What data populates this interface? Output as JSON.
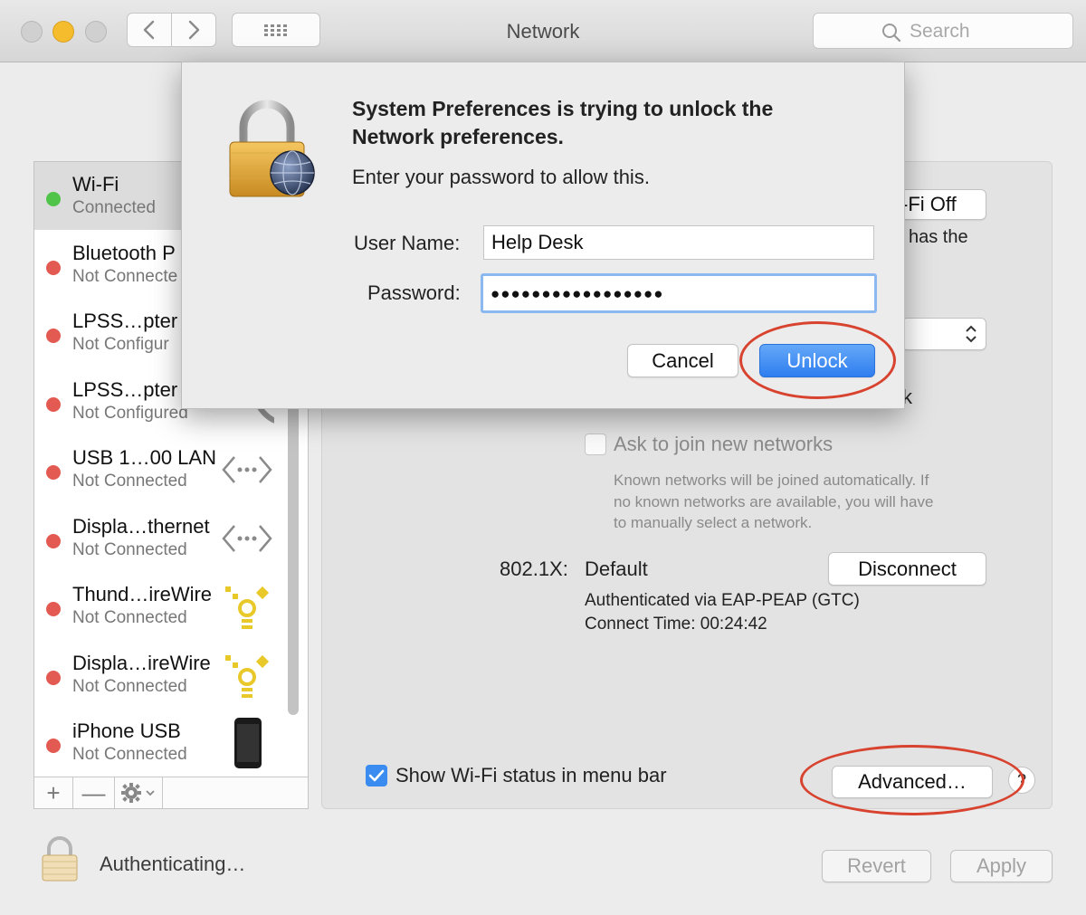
{
  "window": {
    "title": "Network",
    "search_placeholder": "Search"
  },
  "dialog": {
    "heading_line1": "System Preferences is trying to unlock the",
    "heading_line2": "Network preferences.",
    "prompt": "Enter your password to allow this.",
    "username_label": "User Name:",
    "username_value": "Help Desk",
    "password_label": "Password:",
    "password_mask": "●●●●●●●●●●●●●●●●●",
    "cancel_label": "Cancel",
    "unlock_label": "Unlock"
  },
  "sidebar": {
    "items": [
      {
        "name": "Wi-Fi",
        "status": "Connected",
        "dot": "#4fc449"
      },
      {
        "name": "Bluetooth P",
        "status": "Not Connecte",
        "dot": "#e35a52"
      },
      {
        "name": "LPSS…pter",
        "status": "Not Configur",
        "dot": "#e35a52"
      },
      {
        "name": "LPSS…pter",
        "status": "Not Configured",
        "dot": "#e35a52"
      },
      {
        "name": "USB 1…00 LAN",
        "status": "Not Connected",
        "dot": "#e35a52"
      },
      {
        "name": "Displa…thernet",
        "status": "Not Connected",
        "dot": "#e35a52"
      },
      {
        "name": "Thund…ireWire",
        "status": "Not Connected",
        "dot": "#e35a52"
      },
      {
        "name": "Displa…ireWire",
        "status": "Not Connected",
        "dot": "#e35a52"
      },
      {
        "name": "iPhone USB",
        "status": "Not Connected",
        "dot": "#e35a52"
      }
    ],
    "add_label": "+",
    "remove_label": "—"
  },
  "main": {
    "wifi_off_label": "-Fi Off",
    "partial_text": "l has the",
    "partial_k": "k",
    "ask_join_label": "Ask to join new networks",
    "ask_join_desc_1": "Known networks will be joined automatically. If",
    "ask_join_desc_2": "no known networks are available, you will have",
    "ask_join_desc_3": "to manually select a network.",
    "dot1x_label": "802.1X:",
    "dot1x_value": "Default",
    "disconnect_label": "Disconnect",
    "auth_line": "Authenticated via EAP-PEAP (GTC)",
    "connect_time": "Connect Time: 00:24:42",
    "show_status_label": "Show Wi-Fi status in menu bar",
    "advanced_label": "Advanced…",
    "help_label": "?"
  },
  "footer": {
    "lock_status": "Authenticating…",
    "revert_label": "Revert",
    "apply_label": "Apply"
  },
  "colors": {
    "accent": "#3b8cf1",
    "annotation": "#d8432f"
  }
}
